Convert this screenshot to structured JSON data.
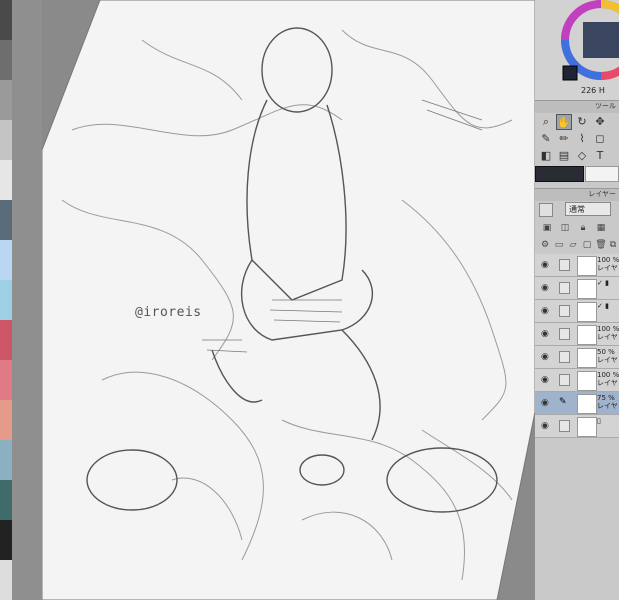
{
  "app": {
    "canvas": {
      "watermark": "@iroreis"
    },
    "color_panel": {
      "hsv_readout": "226 H"
    },
    "tool_palette": {
      "header_label": "ツール"
    },
    "layer_panel": {
      "header_label": "レイヤー",
      "blend_mode": "通常",
      "layers": [
        {
          "opacity_label": "100 %",
          "name": "レイヤ"
        },
        {
          "opacity_label": "",
          "name": ""
        },
        {
          "opacity_label": "",
          "name": ""
        },
        {
          "opacity_label": "100 %",
          "name": "レイヤ"
        },
        {
          "opacity_label": "50 %",
          "name": "レイヤ"
        },
        {
          "opacity_label": "100 %",
          "name": "レイヤ"
        },
        {
          "opacity_label": "75 %",
          "name": "レイヤ"
        },
        {
          "opacity_label": "",
          "name": ""
        }
      ]
    },
    "colors": {
      "main_color": "#2a2c33",
      "sub_color": "#f3f3f3",
      "selected_layer": "#9fb3cc"
    },
    "swatch_colors": [
      "#4a4a4a",
      "#6e6e6e",
      "#9a9a9a",
      "#c4c4c4",
      "#e6e6e6",
      "#5a6b7a",
      "#b9d7f0",
      "#9ed0e3",
      "#cc5566",
      "#e07a84",
      "#e69a8a",
      "#8ab0c2",
      "#3f6b6b",
      "#222222",
      "#dddddd"
    ]
  }
}
